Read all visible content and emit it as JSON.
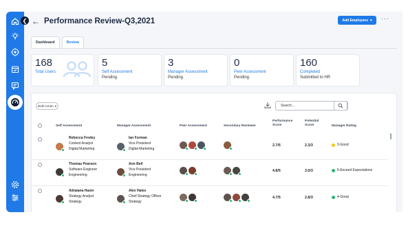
{
  "page": {
    "title": "Performance Review-Q3,2021",
    "add_button": "Add Employees",
    "more": "···"
  },
  "tabs": [
    {
      "label": "Dashboard"
    },
    {
      "label": "Review"
    }
  ],
  "cards": [
    {
      "number": "168",
      "label": "Total Users",
      "sub": ""
    },
    {
      "number": "5",
      "label": "Self Assessment",
      "sub": "Pending"
    },
    {
      "number": "3",
      "label": "Manager Assessment",
      "sub": "Pending"
    },
    {
      "number": "0",
      "label": "Peer Assessment",
      "sub": "Pending"
    },
    {
      "number": "160",
      "label": "Completed",
      "sub": "Submitted to HR"
    }
  ],
  "toolbar": {
    "bulk_action": "Bulk Action",
    "search_placeholder": "Search..."
  },
  "columns": {
    "self": "Self Assessment",
    "manager": "Manager Assessment",
    "peer": "Peer Assessment",
    "secondary": "Secondary Reviewer",
    "performance": "Performance Score",
    "potential": "Potential Score",
    "rating": "Manager Rating"
  },
  "rows": [
    {
      "self_name": "Rebecca Fredey",
      "self_role": "Content Analyst",
      "self_dept": "Digital Marketing",
      "mgr_name": "Ian Forman",
      "mgr_role": "Vice President",
      "mgr_dept": "Digital Marketing",
      "performance": "2.7/5",
      "potential": "2.3/3",
      "rating": "3-Good",
      "rating_color": "#f5c518"
    },
    {
      "self_name": "Thomas Pearson",
      "self_role": "Software Engineer",
      "self_dept": "Engineering",
      "mgr_name": "Ann Bell",
      "mgr_role": "Vice President",
      "mgr_dept": "Engineering",
      "performance": "4.8/5",
      "potential": "3.0/3",
      "rating": "5-Exceed Expectations",
      "rating_color": "#2bb673"
    },
    {
      "self_name": "Adraiana Hasin",
      "self_role": "Strategy Analyst",
      "self_dept": "Strategy",
      "mgr_name": "Alex Hales",
      "mgr_role": "Chief Strategy Officer",
      "mgr_dept": "Strategy",
      "performance": "4.7/5",
      "potential": "2.8/3",
      "rating": "4-Great",
      "rating_color": "#2bb673"
    }
  ],
  "colors": {
    "accent": "#1f7ae8",
    "good": "#f5c518",
    "great": "#2bb673"
  }
}
